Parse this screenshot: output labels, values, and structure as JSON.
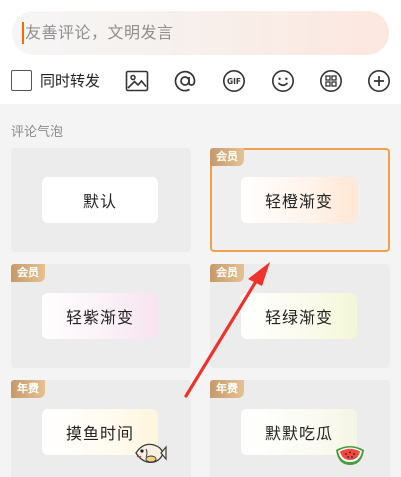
{
  "composer": {
    "placeholder": "友善评论，文明发言",
    "repost_label": "同时转发",
    "tools": [
      "image-icon",
      "at-mention-icon",
      "gif-icon",
      "emoji-icon",
      "topic-icon",
      "add-icon"
    ]
  },
  "bubbles": {
    "section_title": "评论气泡",
    "items": [
      {
        "label": "默认",
        "badge": "",
        "selected": false
      },
      {
        "label": "轻橙渐变",
        "badge": "会员",
        "selected": true
      },
      {
        "label": "轻紫渐变",
        "badge": "会员",
        "selected": false
      },
      {
        "label": "轻绿渐变",
        "badge": "会员",
        "selected": false
      },
      {
        "label": "摸鱼时间",
        "badge": "年费",
        "selected": false,
        "sticker": "fish-sticker-icon"
      },
      {
        "label": "默默吃瓜",
        "badge": "年费",
        "selected": false,
        "sticker": "watermelon-sticker-icon"
      }
    ]
  },
  "colors": {
    "caret": "#ff6a00",
    "selected_border": "#f2a04a",
    "badge": "#d4ad7f",
    "arrow": "#f0322d"
  }
}
